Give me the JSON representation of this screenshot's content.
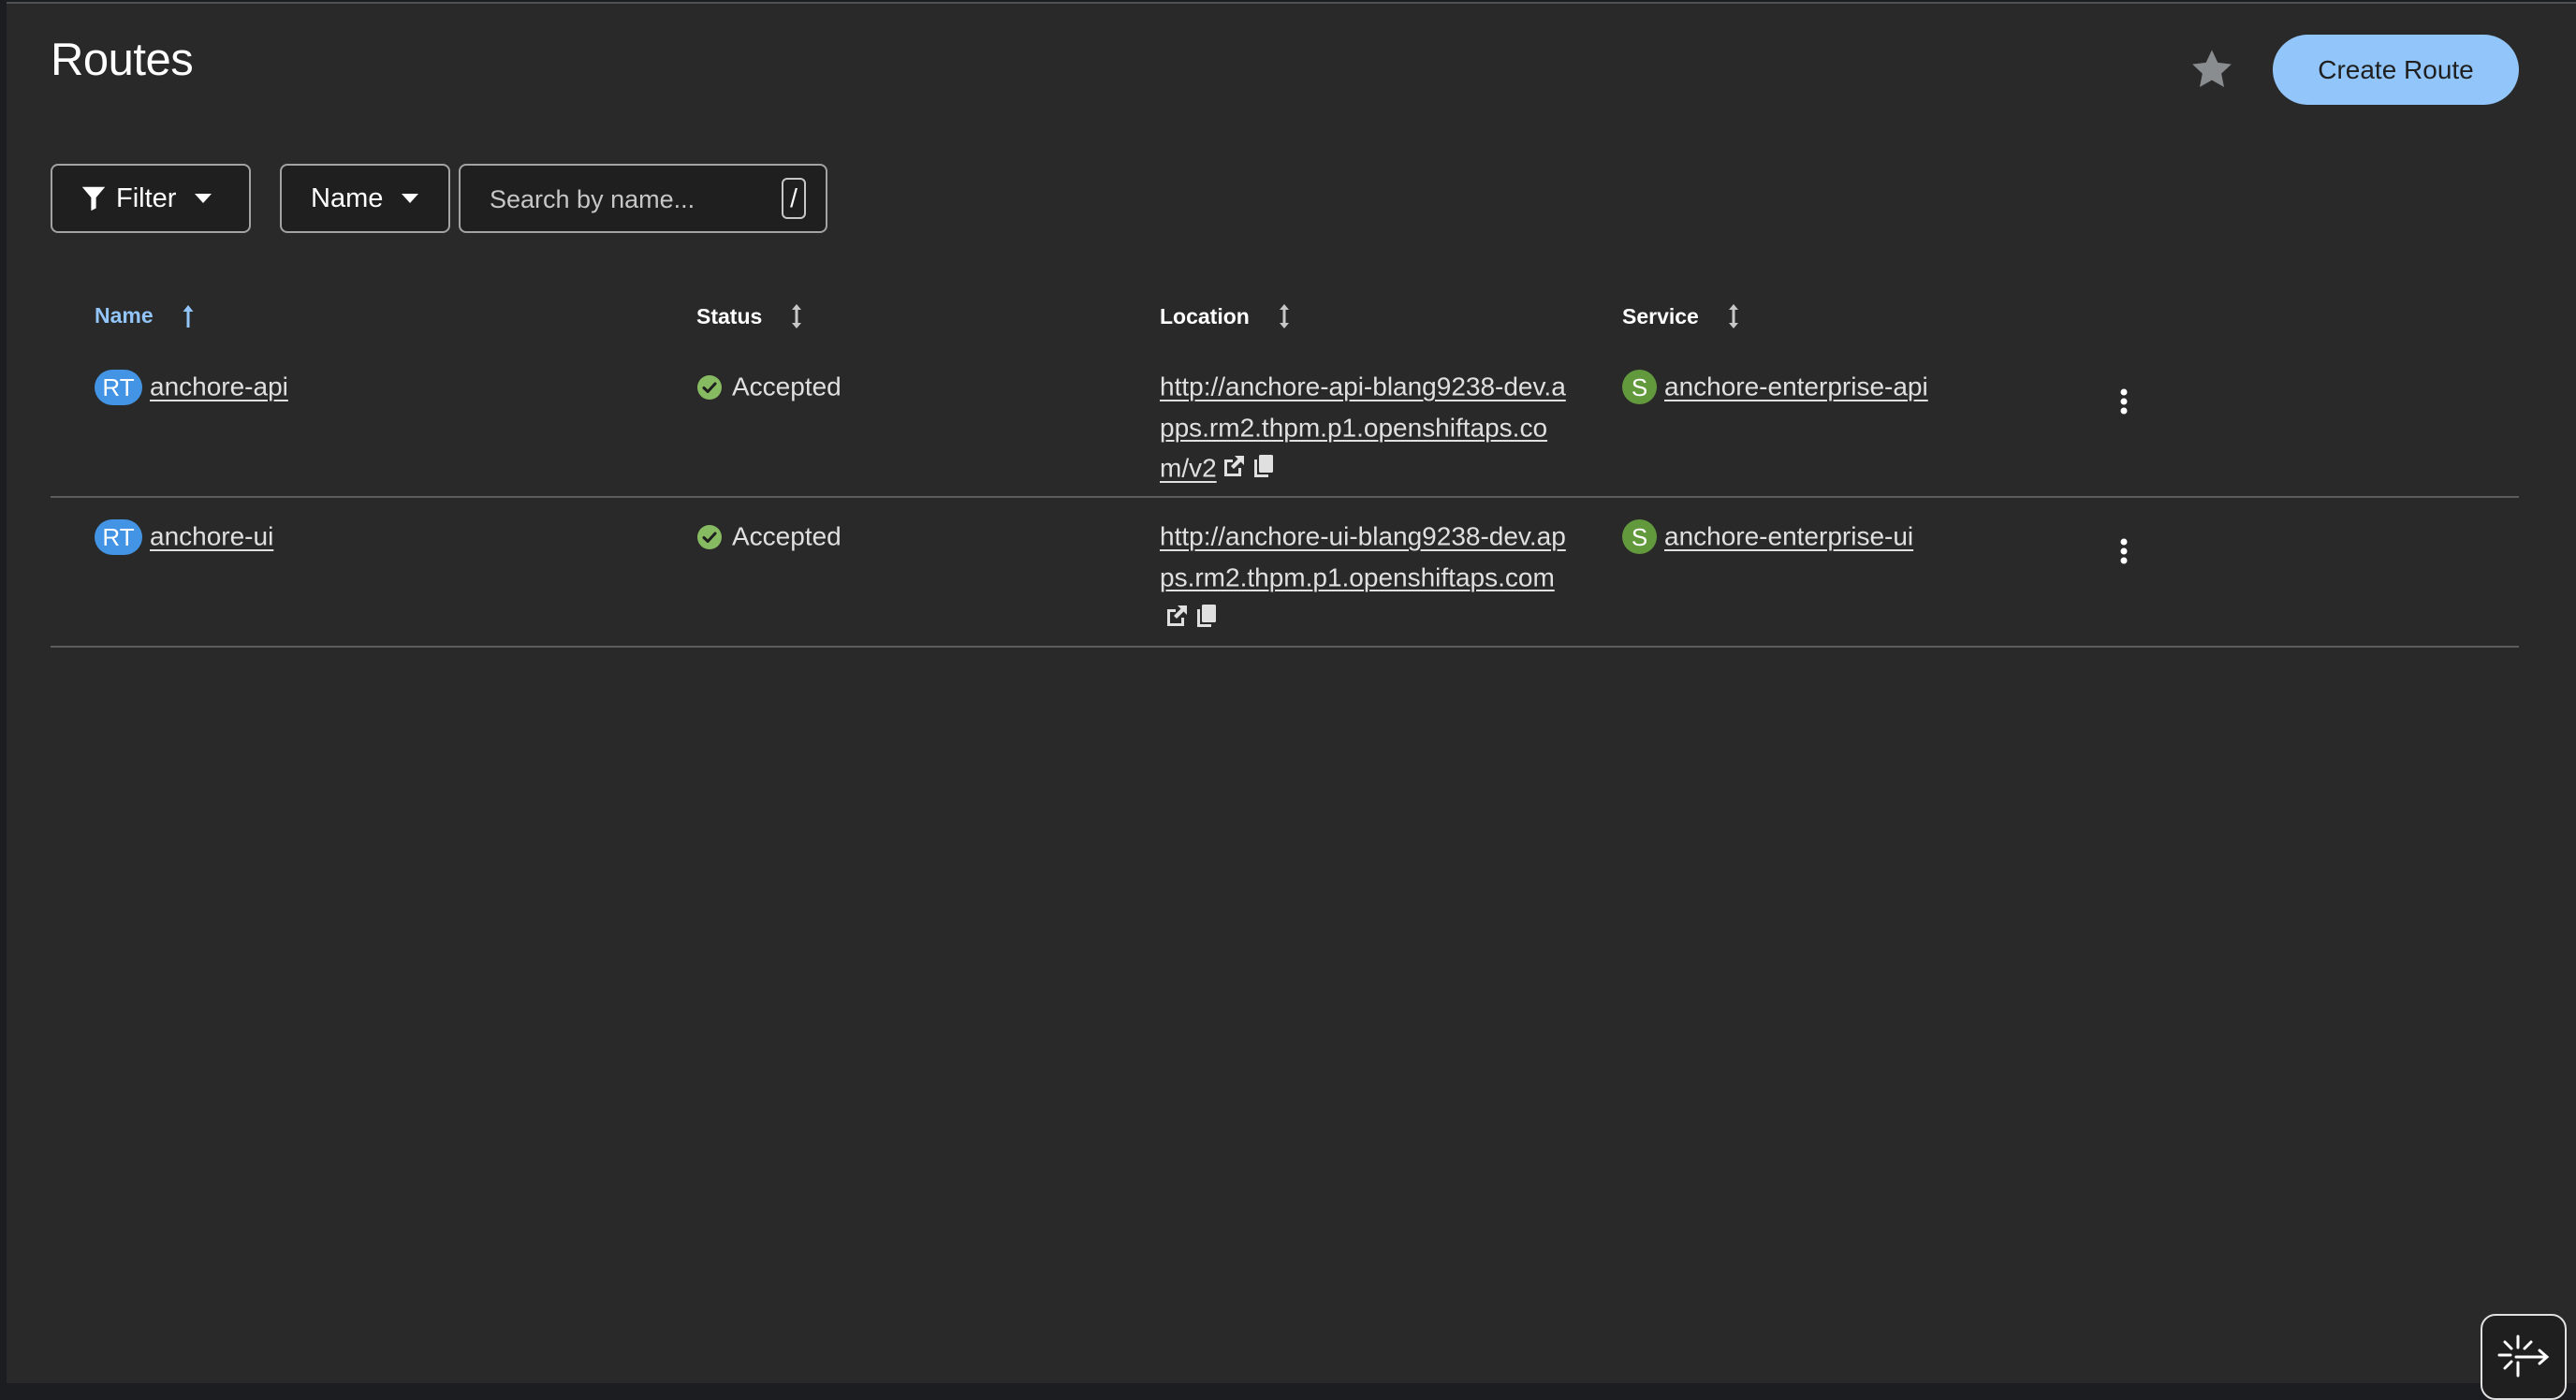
{
  "page": {
    "title": "Routes"
  },
  "header": {
    "favorite_icon": "star-icon",
    "create_button_label": "Create Route"
  },
  "toolbar": {
    "filter_label": "Filter",
    "attribute_label": "Name",
    "search_placeholder": "Search by name...",
    "search_value": "",
    "shortcut_key": "/"
  },
  "table": {
    "columns": {
      "name": "Name",
      "status": "Status",
      "location": "Location",
      "service": "Service"
    },
    "sorted_by": "Name",
    "sort_direction": "ascending",
    "rows": [
      {
        "badge": "RT",
        "name": "anchore-api",
        "status": "Accepted",
        "location": "http://anchore-api-blang9238-dev.apps.rm2.thpm.p1.openshiftaps.com/v2",
        "service_badge": "S",
        "service": "anchore-enterprise-api"
      },
      {
        "badge": "RT",
        "name": "anchore-ui",
        "status": "Accepted",
        "location": "http://anchore-ui-blang9238-dev.apps.rm2.thpm.p1.openshiftaps.com",
        "service_badge": "S",
        "service": "anchore-enterprise-ui"
      }
    ]
  },
  "colors": {
    "background": "#292929",
    "accent": "#92c5f9",
    "route_badge": "#4394e5",
    "service_badge": "#63993d",
    "status_success": "#87bb62"
  }
}
